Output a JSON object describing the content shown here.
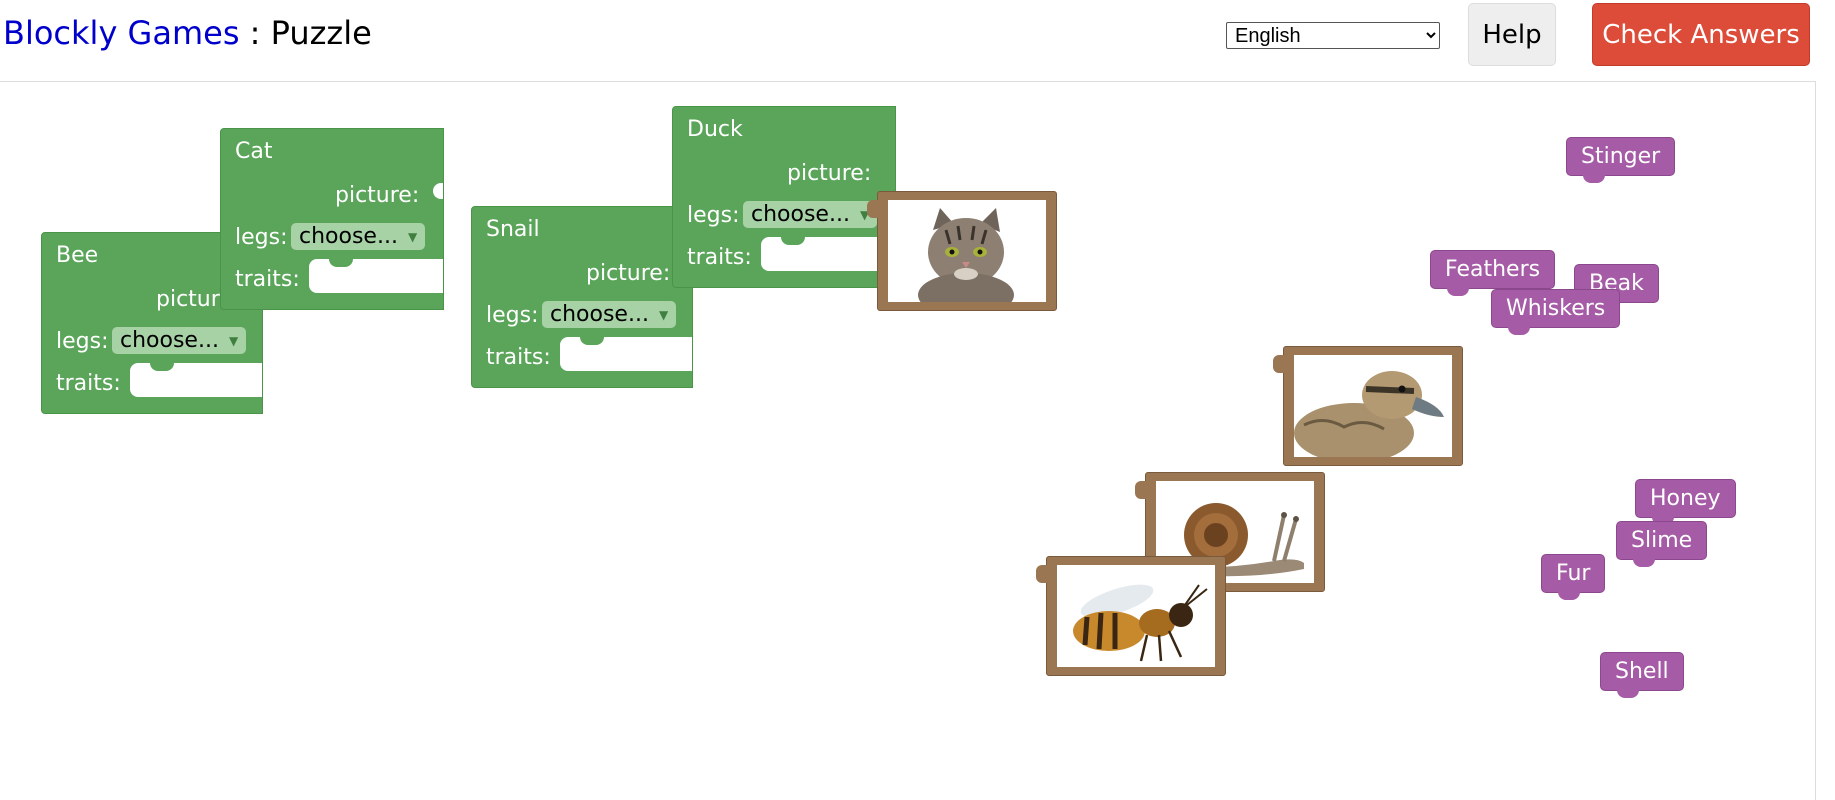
{
  "header": {
    "title_link": "Blockly Games",
    "title_separator": " : ",
    "title_page": "Puzzle",
    "language": "English",
    "help_label": "Help",
    "check_label": "Check Answers"
  },
  "labels": {
    "picture": "picture:",
    "legs": "legs:",
    "traits": "traits:",
    "choose": "choose..."
  },
  "animals": [
    "Bee",
    "Cat",
    "Snail",
    "Duck"
  ],
  "pictures": [
    "cat",
    "duck",
    "snail",
    "bee"
  ],
  "traits": [
    "Stinger",
    "Feathers",
    "Beak",
    "Whiskers",
    "Honey",
    "Slime",
    "Fur",
    "Shell"
  ],
  "colors": {
    "animal_block": "#5ba55b",
    "trait_block": "#a55ba5",
    "picture_frame": "#9b7652",
    "check_button": "#dd4b39",
    "title_link": "#0000cc"
  }
}
